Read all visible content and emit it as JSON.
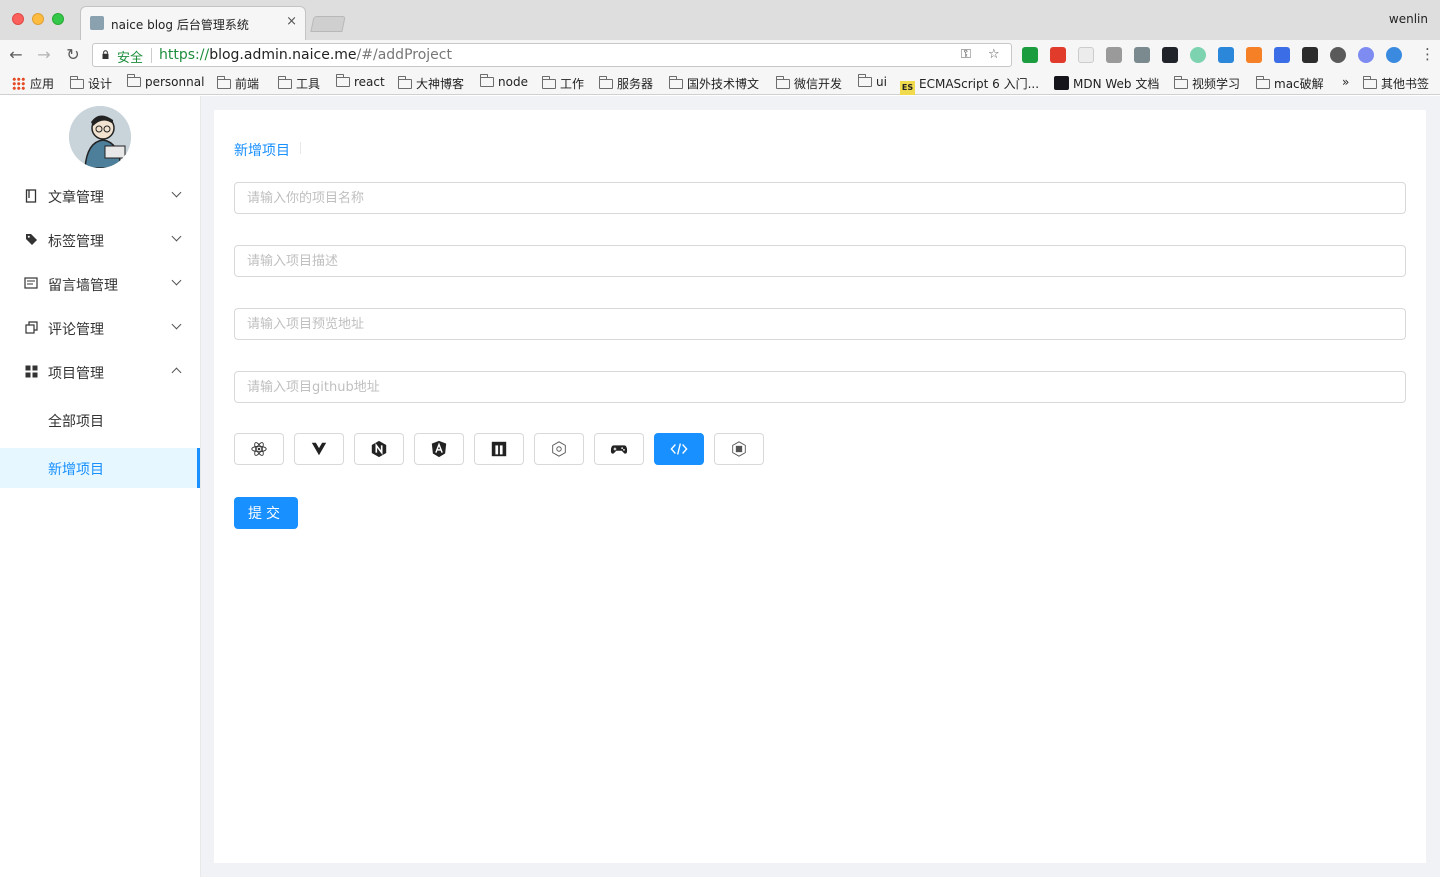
{
  "browser": {
    "tab_title": "naice blog 后台管理系统",
    "tab_close": "×",
    "user": "wenlin",
    "secure_label": "安全",
    "url_scheme": "https://",
    "url_host": "blog.admin.naice.me",
    "url_path": "/#/addProject",
    "bookmarks": [
      "应用",
      "设计",
      "personnal",
      "前端",
      "工具",
      "react",
      "大神博客",
      "node",
      "工作",
      "服务器",
      "国外技术博文",
      "微信开发",
      "ui",
      "ECMAScript 6 入门...",
      "MDN Web 文档",
      "视频学习",
      "mac破解",
      "»",
      "其他书签"
    ]
  },
  "sidebar": {
    "menu": [
      {
        "label": "文章管理",
        "icon": "file-icon"
      },
      {
        "label": "标签管理",
        "icon": "tag-icon"
      },
      {
        "label": "留言墙管理",
        "icon": "message-icon"
      },
      {
        "label": "评论管理",
        "icon": "copy-icon"
      },
      {
        "label": "项目管理",
        "icon": "appstore-icon"
      }
    ],
    "submenu": [
      {
        "label": "全部项目"
      },
      {
        "label": "新增项目",
        "active": true
      }
    ]
  },
  "content": {
    "breadcrumb": "新增项目",
    "fields": {
      "name_placeholder": "请输入你的项目名称",
      "desc_placeholder": "请输入项目描述",
      "preview_placeholder": "请输入项目预览地址",
      "github_placeholder": "请输入项目github地址"
    },
    "tech_icons": [
      "react-icon",
      "vue-icon",
      "nuxt-icon",
      "angular-icon",
      "mdb-icon",
      "settings-hex-icon",
      "gamepad-icon",
      "code-icon",
      "javascript-icon"
    ],
    "selected_icon": "code-icon",
    "submit_label": "提交"
  },
  "colors": {
    "primary": "#1890ff",
    "sidebar_active_bg": "#e6f7ff",
    "page_bg": "#f0f2f5"
  }
}
